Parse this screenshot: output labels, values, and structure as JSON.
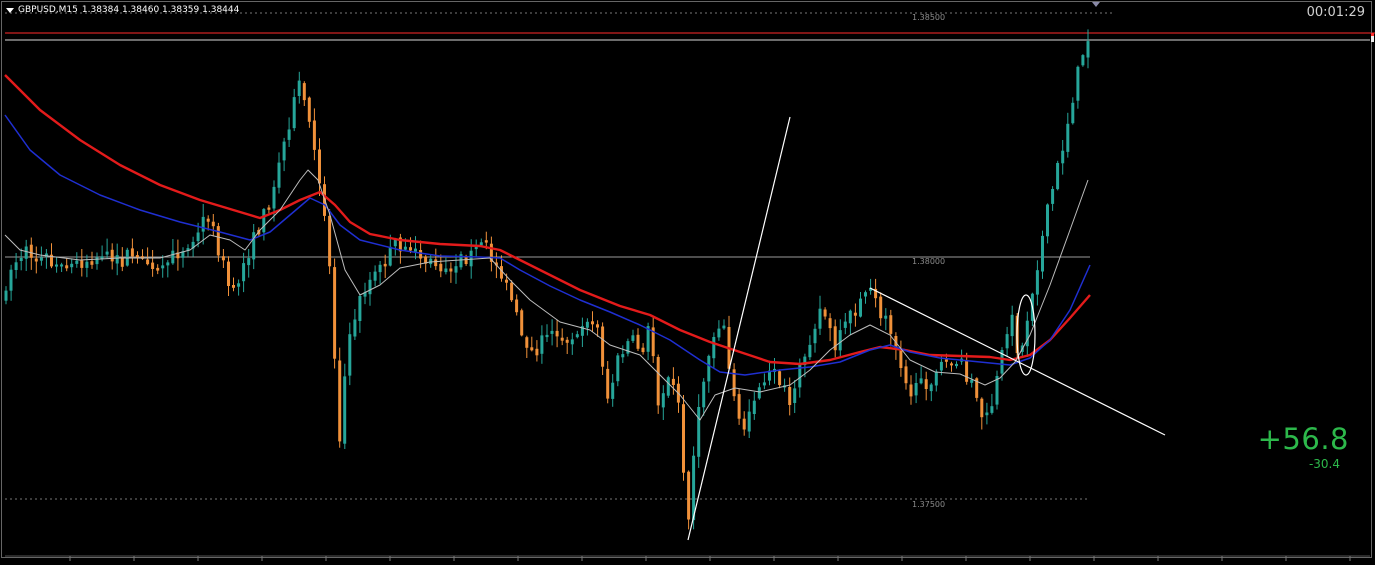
{
  "header": {
    "symbol": "GBPUSD,M15",
    "ohlc": "1.38384 1.38460 1.38359 1.38444"
  },
  "timer": "00:01:29",
  "pnl": {
    "main": "+56.8",
    "sub": "-30.4"
  },
  "levels": {
    "l1": "1.38500",
    "l2": "1.38000",
    "l3": "1.37500"
  },
  "colors": {
    "background": "#000000",
    "bull": "#26a69a",
    "bear": "#f0913a",
    "ma_slow": "#e31b1b",
    "ma_mid": "#1f2fd1",
    "ma_fast": "#bdbdbd",
    "trendline": "#ffffff",
    "price_line": "#ff2a2a",
    "pnl": "#2db84b"
  },
  "chart_data": {
    "type": "candlestick",
    "symbol": "GBPUSD",
    "timeframe": "M15",
    "horizontal_levels": [
      1.385,
      1.38,
      1.375
    ],
    "moving_averages": [
      "red",
      "blue",
      "grey"
    ],
    "candle_count": 215,
    "price_range": [
      1.3743,
      1.3852
    ]
  }
}
